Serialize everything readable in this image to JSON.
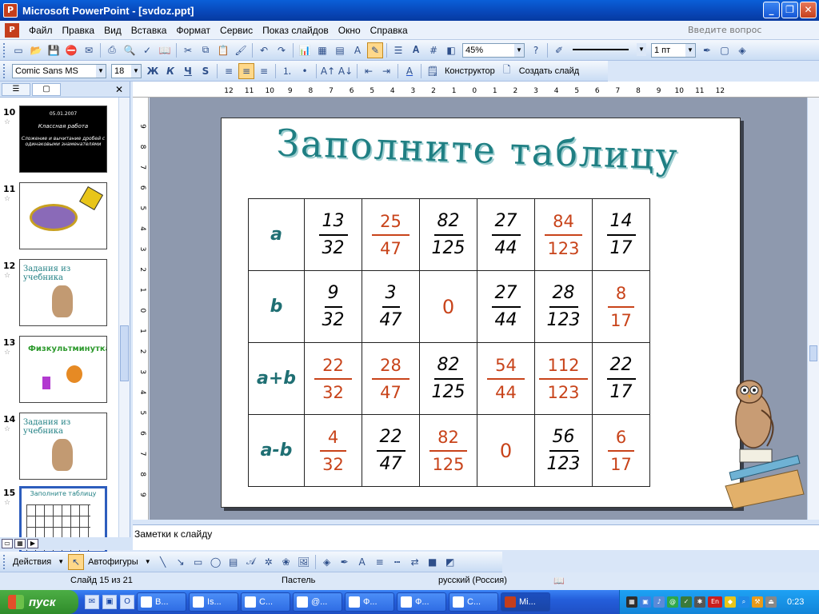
{
  "window": {
    "title": "Microsoft PowerPoint - [svdoz.ppt]"
  },
  "menu": {
    "items": [
      "Файл",
      "Правка",
      "Вид",
      "Вставка",
      "Формат",
      "Сервис",
      "Показ слайдов",
      "Окно",
      "Справка"
    ],
    "ask_placeholder": "Введите вопрос"
  },
  "toolbar": {
    "zoom": "45%",
    "font_name": "Comic Sans MS",
    "font_size": "18",
    "bold": "Ж",
    "italic": "К",
    "underline": "Ч",
    "shadow": "S",
    "line_weight": "1 пт",
    "designer": "Конструктор",
    "new_slide": "Создать слайд"
  },
  "ruler": {
    "top_ticks": [
      "12",
      "11",
      "10",
      "9",
      "8",
      "7",
      "6",
      "5",
      "4",
      "3",
      "2",
      "1",
      "0",
      "1",
      "2",
      "3",
      "4",
      "5",
      "6",
      "7",
      "8",
      "9",
      "10",
      "11",
      "12"
    ],
    "left_ticks": [
      "9",
      "8",
      "7",
      "6",
      "5",
      "4",
      "3",
      "2",
      "1",
      "0",
      "1",
      "2",
      "3",
      "4",
      "5",
      "6",
      "7",
      "8",
      "9"
    ]
  },
  "slides_panel": {
    "entries": [
      {
        "num": "10",
        "kind": "dark",
        "date": "05.01.2007",
        "line1": "Классная работа",
        "line2": "Сложение и вычитание дробей с одинаковыми знаменателями"
      },
      {
        "num": "11",
        "kind": "image"
      },
      {
        "num": "12",
        "kind": "text",
        "caption": "Задания из учебника"
      },
      {
        "num": "13",
        "kind": "text-green",
        "caption": "Физкультминутка"
      },
      {
        "num": "14",
        "kind": "text",
        "caption": "Задания из учебника"
      },
      {
        "num": "15",
        "kind": "selected",
        "caption": "Заполните таблицу"
      }
    ]
  },
  "slide": {
    "title": "Заполните таблицу",
    "rows": [
      {
        "label": "a",
        "cells": [
          {
            "t": "f",
            "n": "13",
            "d": "32"
          },
          {
            "t": "a",
            "n": "25",
            "d": "47"
          },
          {
            "t": "f",
            "n": "82",
            "d": "125"
          },
          {
            "t": "f",
            "n": "27",
            "d": "44"
          },
          {
            "t": "a",
            "n": "84",
            "d": "123"
          },
          {
            "t": "f",
            "n": "14",
            "d": "17"
          }
        ]
      },
      {
        "label": "b",
        "cells": [
          {
            "t": "f",
            "n": "9",
            "d": "32"
          },
          {
            "t": "f",
            "n": "3",
            "d": "47"
          },
          {
            "t": "z",
            "v": "0"
          },
          {
            "t": "f",
            "n": "27",
            "d": "44"
          },
          {
            "t": "f",
            "n": "28",
            "d": "123"
          },
          {
            "t": "a",
            "n": "8",
            "d": "17"
          }
        ]
      },
      {
        "label": "a+b",
        "cells": [
          {
            "t": "a",
            "n": "22",
            "d": "32"
          },
          {
            "t": "a",
            "n": "28",
            "d": "47"
          },
          {
            "t": "f",
            "n": "82",
            "d": "125"
          },
          {
            "t": "a",
            "n": "54",
            "d": "44"
          },
          {
            "t": "a",
            "n": "112",
            "d": "123"
          },
          {
            "t": "f",
            "n": "22",
            "d": "17"
          }
        ]
      },
      {
        "label": "a-b",
        "cells": [
          {
            "t": "a",
            "n": "4",
            "d": "32"
          },
          {
            "t": "f",
            "n": "22",
            "d": "47"
          },
          {
            "t": "a",
            "n": "82",
            "d": "125"
          },
          {
            "t": "z",
            "v": "0"
          },
          {
            "t": "f",
            "n": "56",
            "d": "123"
          },
          {
            "t": "a",
            "n": "6",
            "d": "17"
          }
        ]
      }
    ]
  },
  "notes": {
    "placeholder": "Заметки к слайду"
  },
  "drawing": {
    "actions": "Действия",
    "autoshapes": "Автофигуры"
  },
  "status": {
    "slide": "Слайд 15 из 21",
    "design": "Пастель",
    "language": "русский (Россия)"
  },
  "taskbar": {
    "start": "пуск",
    "tasks": [
      "В...",
      "Is...",
      "С...",
      "@...",
      "Ф...",
      "Ф...",
      "С...",
      "Mi..."
    ],
    "clock": "0:23",
    "lang": "En"
  },
  "colors": {
    "accent_title": "#1f7f83",
    "answer": "#c8431a",
    "titlebar": "#0a5fd8"
  }
}
